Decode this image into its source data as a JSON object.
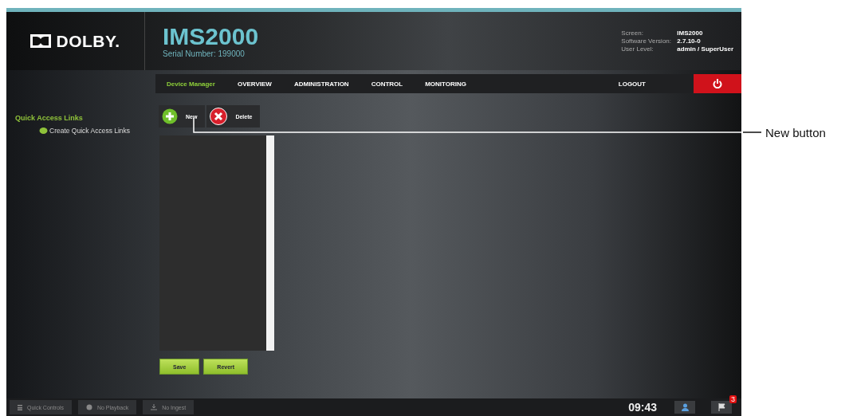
{
  "header": {
    "brand": "DOLBY.",
    "product": "IMS2000",
    "serial": "Serial Number: 199000",
    "info": [
      {
        "label": "Screen:",
        "value": "IMS2000"
      },
      {
        "label": "Software Version:",
        "value": "2.7.10-0"
      },
      {
        "label": "User Level:",
        "value": "admin / SuperUser"
      }
    ]
  },
  "nav": {
    "items": [
      {
        "label": "Device Manager",
        "selected": true
      },
      {
        "label": "OVERVIEW",
        "selected": false
      },
      {
        "label": "ADMINISTRATION",
        "selected": false
      },
      {
        "label": "CONTROL",
        "selected": false
      },
      {
        "label": "MONITORING",
        "selected": false
      }
    ],
    "logout": "LOGOUT"
  },
  "sidebar": {
    "title": "Quick Access Links",
    "link": "Create Quick Access Links"
  },
  "toolbar": [
    {
      "kind": "add",
      "label": "New"
    },
    {
      "kind": "delete",
      "label": "Delete"
    }
  ],
  "actions": [
    "Save",
    "Revert"
  ],
  "status_bar": {
    "buttons": [
      {
        "kind": "controls",
        "label": "Quick Controls"
      },
      {
        "kind": "playback",
        "label": "No Playback"
      },
      {
        "kind": "ingest",
        "label": "No Ingest"
      }
    ],
    "time": "09:43",
    "badge": "3"
  },
  "callout": "New button"
}
